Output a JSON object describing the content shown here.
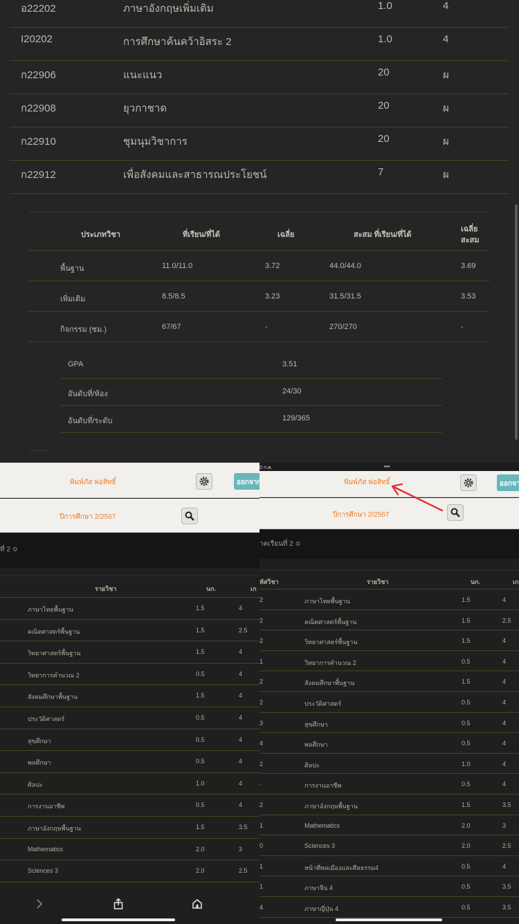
{
  "course_rows": [
    {
      "code": "อ22202",
      "name": "ภาษาอังกฤษเพิ่มเติม",
      "credit": "1.0",
      "grade": "4"
    },
    {
      "code": "I20202",
      "name": "การศึกษาค้นคว้าอิสระ 2",
      "credit": "1.0",
      "grade": "4"
    },
    {
      "code": "ก22906",
      "name": "แนะแนว",
      "credit": "20",
      "grade": "ผ"
    },
    {
      "code": "ก22908",
      "name": "ยุวกาชาด",
      "credit": "20",
      "grade": "ผ"
    },
    {
      "code": "ก22910",
      "name": "ชุมนุมวิชาการ",
      "credit": "20",
      "grade": "ผ"
    },
    {
      "code": "ก22912",
      "name": "เพื่อสังคมและสาธารณประโยชน์",
      "credit": "7",
      "grade": "ผ"
    }
  ],
  "summary": {
    "headers": {
      "type": "ประเภทวิชา",
      "studied": "ที่เรียน/ที่ได้",
      "avg": "เฉลี่ย",
      "cum_studied": "สะสม ที่เรียน/ที่ได้",
      "cum_avg_1": "เฉลี่ย",
      "cum_avg_2": "สะสม"
    },
    "rows": [
      {
        "type": "พื้นฐาน",
        "studied": "11.0/11.0",
        "avg": "3.72",
        "cum": "44.0/44.0",
        "cum_avg": "3.69"
      },
      {
        "type": "เพิ่มเติม",
        "studied": "8.5/8.5",
        "avg": "3.23",
        "cum": "31.5/31.5",
        "cum_avg": "3.53"
      },
      {
        "type": "กิจกรรม (ชม.)",
        "studied": "67/67",
        "avg": "-",
        "cum": "270/270",
        "cum_avg": "-"
      }
    ]
  },
  "gpa_rows": [
    {
      "label": "GPA",
      "value": "3.51"
    },
    {
      "label": "อันดับที่/ห้อง",
      "value": "24/30"
    },
    {
      "label": "อันดับที่/ระดับ",
      "value": "129/365"
    }
  ],
  "left": {
    "student_name": "พิมพ์ภัส พ่อสิทธิ์",
    "academic_year": "ปีการศึกษา 2/2567",
    "logout_label": "ออกจาก",
    "term_fragment": "ที่ 2 ≎",
    "head_subject": "รายวิชา",
    "head_credit": "นก.",
    "head_grade": "เก",
    "subjects": [
      {
        "name": "ภาษาไทยพื้นฐาน",
        "credit": "1.5",
        "grade": "4"
      },
      {
        "name": "คณิตศาสตร์พื้นฐาน",
        "credit": "1.5",
        "grade": "2.5"
      },
      {
        "name": "วิทยาศาสตร์พื้นฐาน",
        "credit": "1.5",
        "grade": "4"
      },
      {
        "name": "วิทยาการคำนวณ 2",
        "credit": "0.5",
        "grade": "4"
      },
      {
        "name": "สังคมศึกษาพื้นฐาน",
        "credit": "1.5",
        "grade": "4"
      },
      {
        "name": "ประวัติศาสตร์",
        "credit": "0.5",
        "grade": "4"
      },
      {
        "name": "สุขศึกษา",
        "credit": "0.5",
        "grade": "4"
      },
      {
        "name": "พลศึกษา",
        "credit": "0.5",
        "grade": "4"
      },
      {
        "name": "ศิลปะ",
        "credit": "1.0",
        "grade": "4"
      },
      {
        "name": "การงานอาชีพ",
        "credit": "0.5",
        "grade": "4"
      },
      {
        "name": "ภาษาอังกฤษพื้นฐาน",
        "credit": "1.5",
        "grade": "3.5"
      },
      {
        "name": "Mathematics",
        "credit": "2.0",
        "grade": "3"
      },
      {
        "name": "Sciences 3",
        "credit": "2.0",
        "grade": "2.5"
      }
    ]
  },
  "right": {
    "status_time": "0 ก.ค.",
    "status_dots": "•••",
    "student_name": "พิมพ์ภัส พ่อสิทธิ์",
    "academic_year": "ปีการศึกษา 2/2567",
    "logout_label": "ออกจา",
    "term_fragment": "าคเรียนที่ 2 ≎",
    "head_code": "หัสวิชา",
    "head_subject": "รายวิชา",
    "head_credit": "นก.",
    "head_grade": "เก",
    "subjects": [
      {
        "code": "2",
        "name": "ภาษาไทยพื้นฐาน",
        "credit": "1.5",
        "grade": "4"
      },
      {
        "code": "2",
        "name": "คณิตศาสตร์พื้นฐาน",
        "credit": "1.5",
        "grade": "2.5"
      },
      {
        "code": "2",
        "name": "วิทยาศาสตร์พื้นฐาน",
        "credit": "1.5",
        "grade": "4"
      },
      {
        "code": "1",
        "name": "วิทยาการคำนวณ 2",
        "credit": "0.5",
        "grade": "4"
      },
      {
        "code": "2",
        "name": "สังคมศึกษาพื้นฐาน",
        "credit": "1.5",
        "grade": "4"
      },
      {
        "code": "2",
        "name": "ประวัติศาสตร์",
        "credit": "0.5",
        "grade": "4"
      },
      {
        "code": "3",
        "name": "สุขศึกษา",
        "credit": "0.5",
        "grade": "4"
      },
      {
        "code": "4",
        "name": "พลศึกษา",
        "credit": "0.5",
        "grade": "4"
      },
      {
        "code": "2",
        "name": "ศิลปะ",
        "credit": "1.0",
        "grade": "4"
      },
      {
        "code": "·",
        "name": "การงานอาชีพ",
        "credit": "0.5",
        "grade": "4"
      },
      {
        "code": "2",
        "name": "ภาษาอังกฤษพื้นฐาน",
        "credit": "1.5",
        "grade": "3.5"
      },
      {
        "code": "1",
        "name": "Mathematics",
        "credit": "2.0",
        "grade": "3"
      },
      {
        "code": "0",
        "name": "Sciences 3",
        "credit": "2.0",
        "grade": "2.5"
      },
      {
        "code": "1",
        "name": "หน้าที่พลเมืองและศีลธรรม4",
        "credit": "0.5",
        "grade": "4"
      },
      {
        "code": "1",
        "name": "ภาษาจีน 4",
        "credit": "0.5",
        "grade": "3.5"
      },
      {
        "code": "4",
        "name": "ภาษาญี่ปุ่น 4",
        "credit": "0.5",
        "grade": "3.5"
      }
    ]
  },
  "icons": {
    "gear": "gear-icon",
    "search": "search-icon",
    "forward": "chevron-right-icon",
    "share": "share-icon",
    "home": "home-icon",
    "arrow": "red-arrow-annotation"
  },
  "colors": {
    "accent_orange": "#f07d24",
    "logout_teal": "#67b7bb",
    "annotation_red": "#e0303a",
    "background": "#252525",
    "row_divider": "#4a4320"
  }
}
